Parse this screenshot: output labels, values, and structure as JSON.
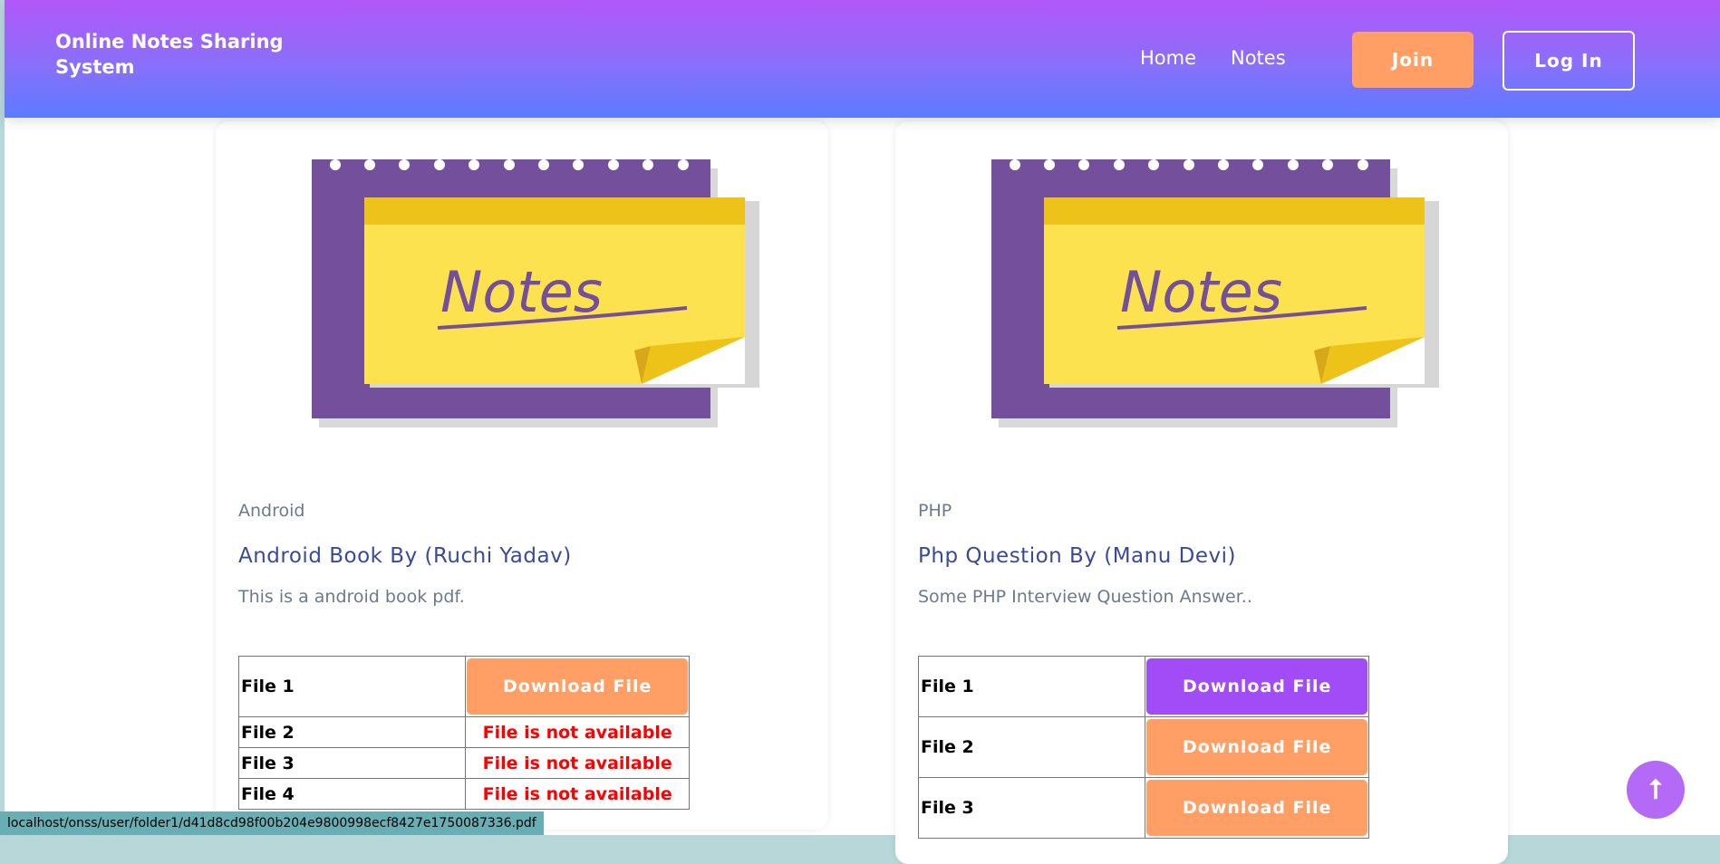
{
  "header": {
    "brand": "Online Notes Sharing System",
    "nav": [
      "Home",
      "Notes"
    ],
    "join_label": "Join",
    "login_label": "Log In"
  },
  "cards": [
    {
      "image_text": "Notes",
      "category": "Android",
      "title": "Android Book By (Ruchi Yadav)",
      "description": "This is a android book pdf.",
      "files": [
        {
          "label": "File 1",
          "action": "Download File"
        },
        {
          "label": "File 2",
          "action": "File is not available"
        },
        {
          "label": "File 3",
          "action": "File is not available"
        },
        {
          "label": "File 4",
          "action": "File is not available"
        }
      ]
    },
    {
      "image_text": "Notes",
      "category": "PHP",
      "title": "Php Question By (Manu Devi)",
      "description": "Some PHP Interview Question Answer..",
      "files": [
        {
          "label": "File 1",
          "action": "Download File"
        },
        {
          "label": "File 2",
          "action": "Download File"
        },
        {
          "label": "File 3",
          "action": "Download File"
        }
      ]
    }
  ],
  "status_bar": "localhost/onss/user/folder1/d41d8cd98f00b204e9800998ecf8427e1750087336.pdf",
  "scroll_top_icon": "arrow-up-icon",
  "colors": {
    "header_top": "#b257f9",
    "header_bottom": "#5b7bff",
    "accent_orange": "#ff9f66",
    "accent_purple": "#a14cf7",
    "error_red": "#ff0000",
    "title_blue": "#3a4a9a"
  }
}
